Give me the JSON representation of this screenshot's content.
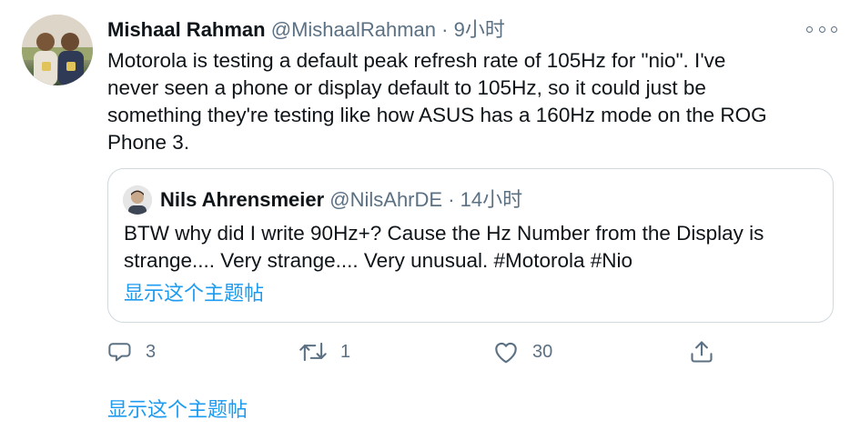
{
  "tweet": {
    "author_name": "Mishaal Rahman",
    "author_handle": "@MishaalRahman",
    "separator": "·",
    "time": "9小时",
    "text": "Motorola is testing a default peak refresh rate of 105Hz for \"nio\". I've\nnever seen a phone or display default to 105Hz, so it could just be\nsomething they're testing like how ASUS has a 160Hz mode on the ROG\nPhone 3."
  },
  "quoted": {
    "author_name": "Nils Ahrensmeier",
    "author_handle": "@NilsAhrDE",
    "separator": "·",
    "time": "14小时",
    "text": "BTW why did I write 90Hz+? Cause the Hz Number from the Display is strange.... Very strange.... Very unusual. #Motorola #Nio",
    "show_thread": "显示这个主题帖"
  },
  "actions": {
    "reply_count": "3",
    "retweet_count": "1",
    "like_count": "30"
  },
  "show_thread": "显示这个主题帖",
  "icons": {
    "more": "more-icon",
    "reply": "reply-icon",
    "retweet": "retweet-icon",
    "like": "like-icon",
    "share": "share-icon"
  },
  "colors": {
    "text": "#0f1419",
    "secondary": "#5b7083",
    "link": "#1d9bf0",
    "border": "#cfd9de"
  }
}
